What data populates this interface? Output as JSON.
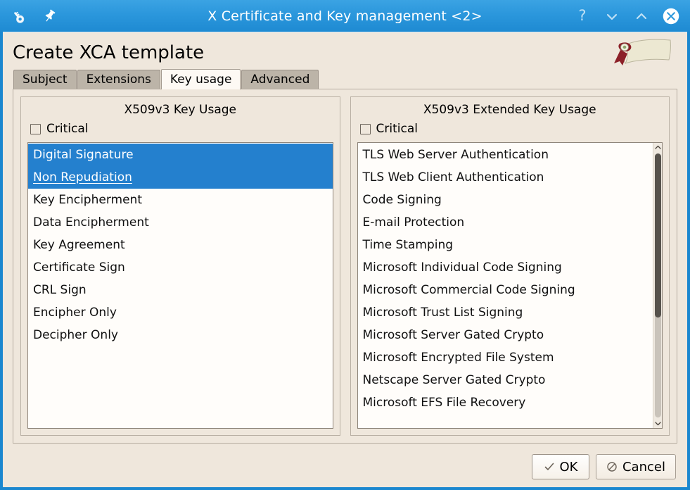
{
  "titlebar": {
    "title": "X Certificate and Key management <2>",
    "left_icons": [
      {
        "name": "key-icon",
        "label": "key"
      },
      {
        "name": "pin-icon",
        "label": "pin"
      }
    ],
    "right_icons": [
      {
        "name": "help-icon",
        "label": "?"
      },
      {
        "name": "minimize-icon",
        "label": "minimize"
      },
      {
        "name": "maximize-icon",
        "label": "maximize"
      },
      {
        "name": "close-icon",
        "label": "close"
      }
    ],
    "bg_color": "#2b97dc"
  },
  "header": {
    "page_title": "Create XCA template",
    "logo_name": "certificate-scroll-logo"
  },
  "tabs": [
    {
      "label": "Subject",
      "active": false
    },
    {
      "label": "Extensions",
      "active": false
    },
    {
      "label": "Key usage",
      "active": true
    },
    {
      "label": "Advanced",
      "active": false
    }
  ],
  "key_usage": {
    "group_title": "X509v3 Key Usage",
    "critical_label": "Critical",
    "critical_checked": false,
    "items": [
      {
        "label": "Digital Signature",
        "selected": true,
        "focused": false
      },
      {
        "label": "Non Repudiation",
        "selected": true,
        "focused": true
      },
      {
        "label": "Key Encipherment",
        "selected": false,
        "focused": false
      },
      {
        "label": "Data Encipherment",
        "selected": false,
        "focused": false
      },
      {
        "label": "Key Agreement",
        "selected": false,
        "focused": false
      },
      {
        "label": "Certificate Sign",
        "selected": false,
        "focused": false
      },
      {
        "label": "CRL Sign",
        "selected": false,
        "focused": false
      },
      {
        "label": "Encipher Only",
        "selected": false,
        "focused": false
      },
      {
        "label": "Decipher Only",
        "selected": false,
        "focused": false
      }
    ],
    "has_scrollbar": false
  },
  "extended_key_usage": {
    "group_title": "X509v3 Extended Key Usage",
    "critical_label": "Critical",
    "critical_checked": false,
    "items": [
      {
        "label": "TLS Web Server Authentication",
        "selected": false,
        "focused": false
      },
      {
        "label": "TLS Web Client Authentication",
        "selected": false,
        "focused": false
      },
      {
        "label": "Code Signing",
        "selected": false,
        "focused": false
      },
      {
        "label": "E-mail Protection",
        "selected": false,
        "focused": false
      },
      {
        "label": "Time Stamping",
        "selected": false,
        "focused": false
      },
      {
        "label": "Microsoft Individual Code Signing",
        "selected": false,
        "focused": false
      },
      {
        "label": "Microsoft Commercial Code Signing",
        "selected": false,
        "focused": false
      },
      {
        "label": "Microsoft Trust List Signing",
        "selected": false,
        "focused": false
      },
      {
        "label": "Microsoft Server Gated Crypto",
        "selected": false,
        "focused": false
      },
      {
        "label": "Microsoft Encrypted File System",
        "selected": false,
        "focused": false
      },
      {
        "label": "Netscape Server Gated Crypto",
        "selected": false,
        "focused": false
      },
      {
        "label": "Microsoft EFS File Recovery",
        "selected": false,
        "focused": false
      }
    ],
    "has_scrollbar": true,
    "scroll_thumb_percent": 62,
    "scroll_up_icon": "chevron-up-icon",
    "scroll_down_icon": "chevron-down-icon"
  },
  "buttons": {
    "ok_label": "OK",
    "cancel_label": "Cancel",
    "ok_icon": "check-icon",
    "cancel_icon": "no-entry-icon"
  },
  "colors": {
    "selection_blue": "#2480ce",
    "dialog_bg": "#efe7dc",
    "title_blue": "#2b97dc",
    "list_bg": "#fffdfa"
  }
}
